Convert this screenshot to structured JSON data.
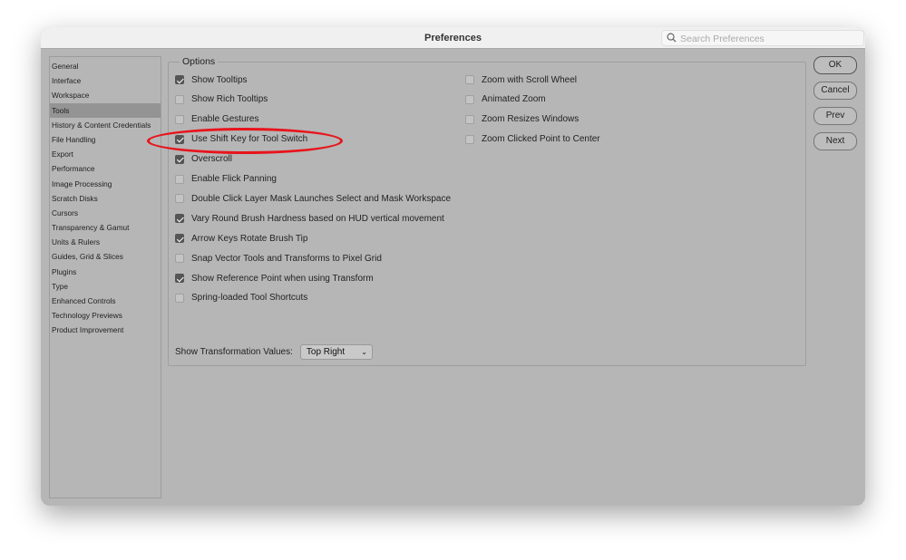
{
  "window": {
    "title": "Preferences",
    "search_placeholder": "Search Preferences"
  },
  "sidebar": {
    "items": [
      "General",
      "Interface",
      "Workspace",
      "Tools",
      "History & Content Credentials",
      "File Handling",
      "Export",
      "Performance",
      "Image Processing",
      "Scratch Disks",
      "Cursors",
      "Transparency & Gamut",
      "Units & Rulers",
      "Guides, Grid & Slices",
      "Plugins",
      "Type",
      "Enhanced Controls",
      "Technology Previews",
      "Product Improvement"
    ],
    "selected": "Tools"
  },
  "options": {
    "label": "Options",
    "left": [
      {
        "label": "Show Tooltips",
        "checked": true
      },
      {
        "label": "Show Rich Tooltips",
        "checked": false
      },
      {
        "label": "Enable Gestures",
        "checked": false
      },
      {
        "label": "Use Shift Key for Tool Switch",
        "checked": true
      },
      {
        "label": "Overscroll",
        "checked": true
      },
      {
        "label": "Enable Flick Panning",
        "checked": false
      },
      {
        "label": "Double Click Layer Mask Launches Select and Mask Workspace",
        "checked": false
      },
      {
        "label": "Vary Round Brush Hardness based on HUD vertical movement",
        "checked": true
      },
      {
        "label": "Arrow Keys Rotate Brush Tip",
        "checked": true
      },
      {
        "label": "Snap Vector Tools and Transforms to Pixel Grid",
        "checked": false
      },
      {
        "label": "Show Reference Point when using Transform",
        "checked": true
      },
      {
        "label": "Spring-loaded Tool Shortcuts",
        "checked": false
      }
    ],
    "right": [
      {
        "label": "Zoom with Scroll Wheel",
        "checked": false
      },
      {
        "label": "Animated Zoom",
        "checked": false
      },
      {
        "label": "Zoom Resizes Windows",
        "checked": false
      },
      {
        "label": "Zoom Clicked Point to Center",
        "checked": false
      }
    ],
    "transformation": {
      "label": "Show Transformation Values:",
      "value": "Top Right"
    }
  },
  "buttons": {
    "ok": "OK",
    "cancel": "Cancel",
    "prev": "Prev",
    "next": "Next"
  },
  "annotation": {
    "color": "#e8141c"
  }
}
